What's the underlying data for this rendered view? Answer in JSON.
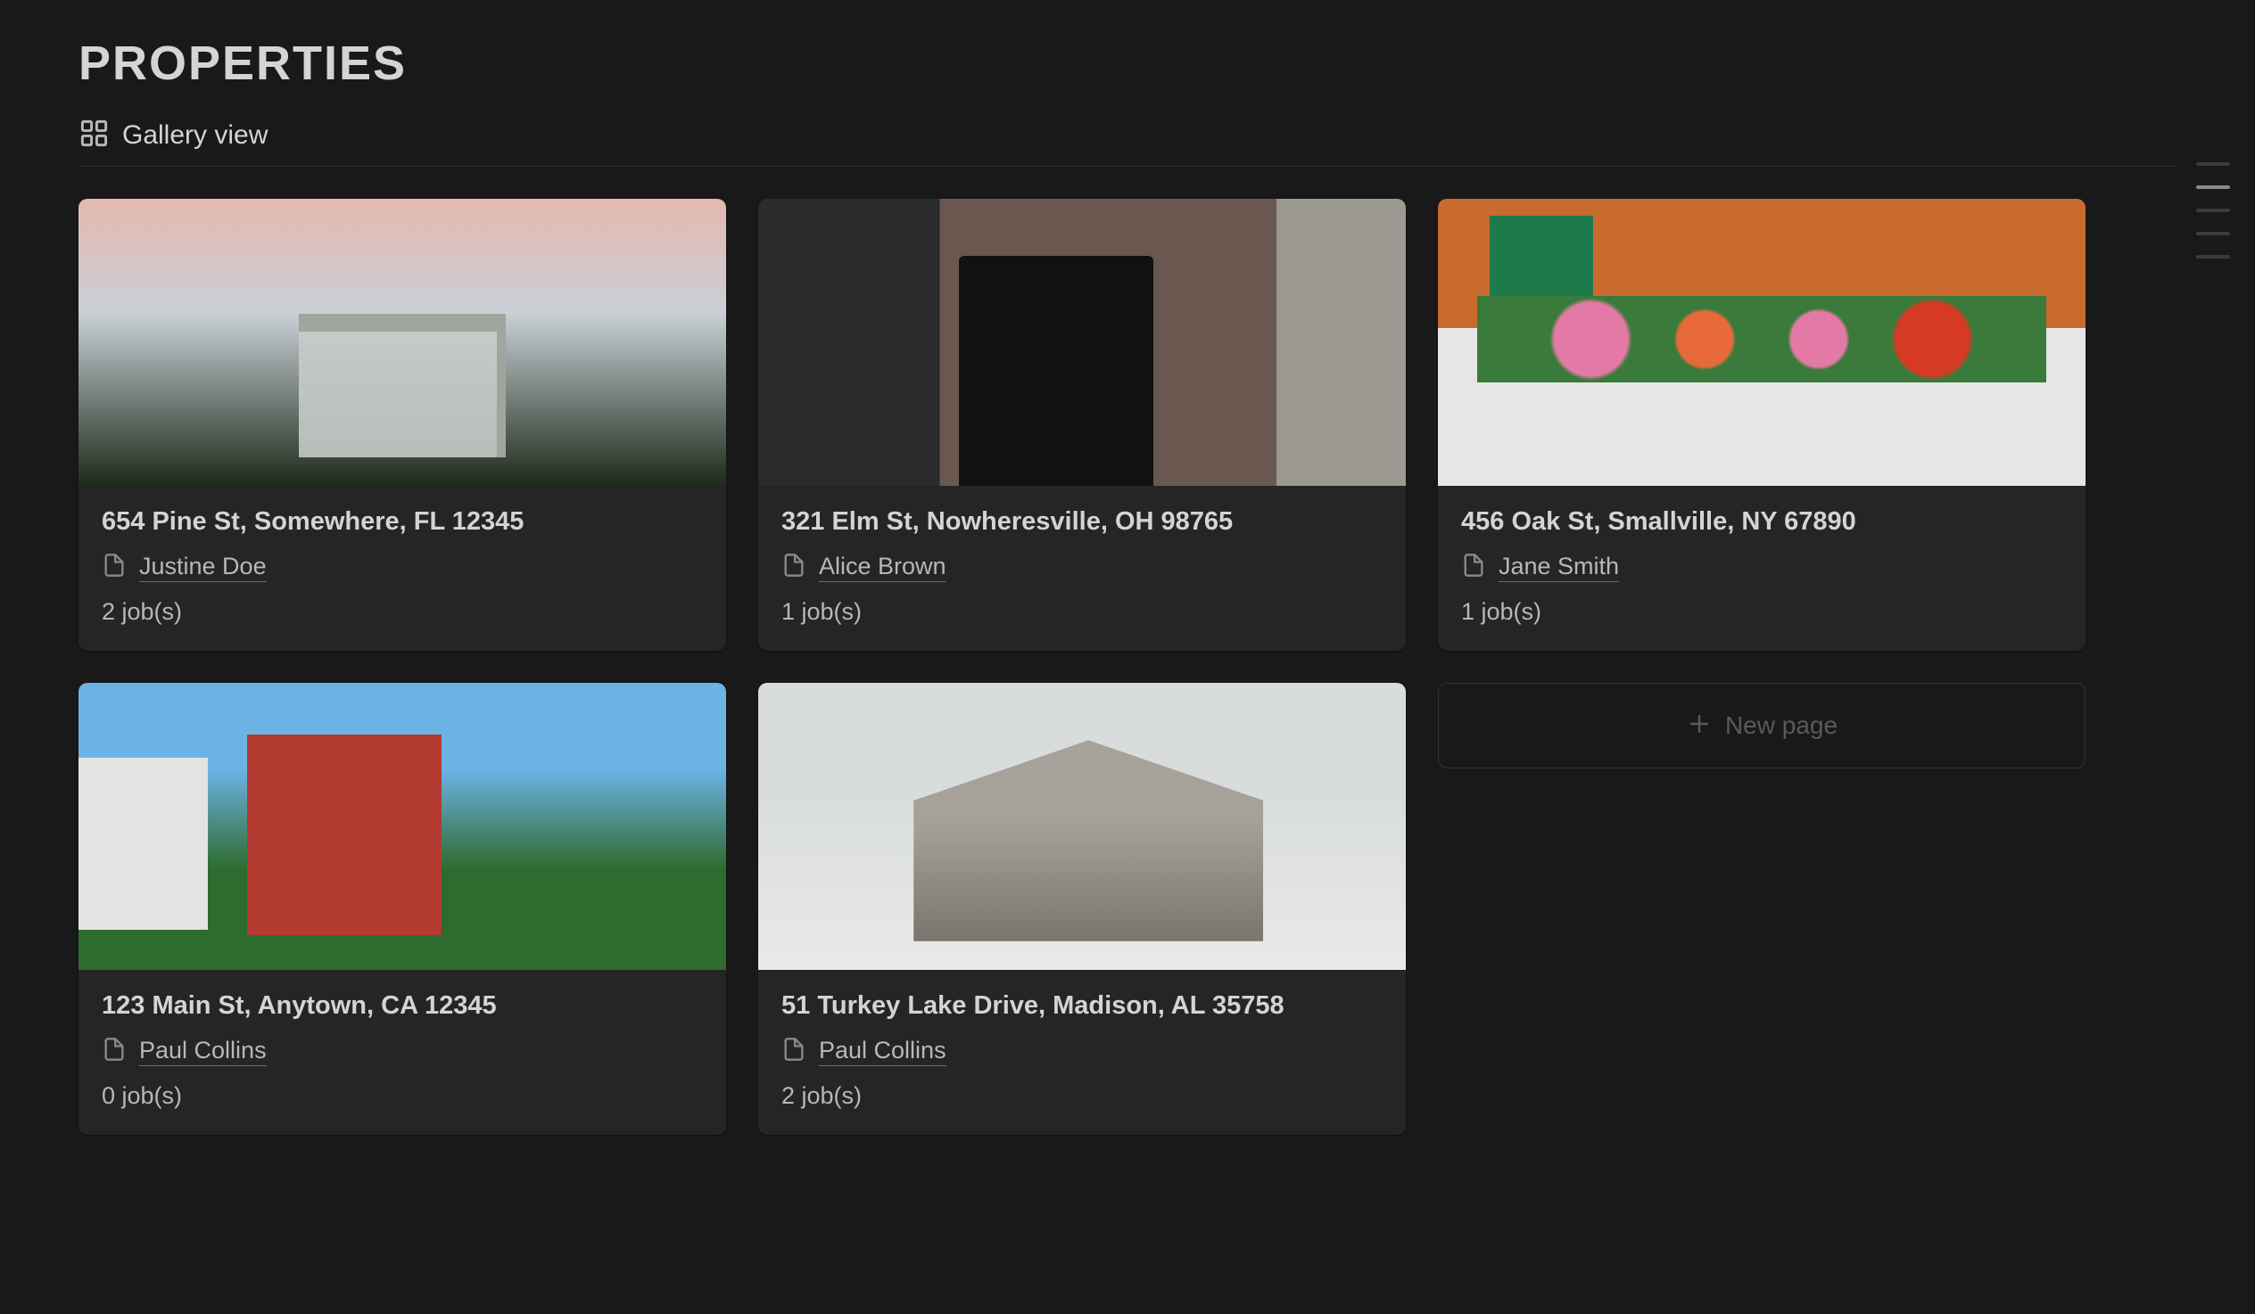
{
  "page_title": "PROPERTIES",
  "view": {
    "label": "Gallery view"
  },
  "new_page": {
    "label": "New page"
  },
  "properties": [
    {
      "address": "654 Pine St, Somewhere, FL 12345",
      "person": "Justine Doe",
      "jobs": "2 job(s)"
    },
    {
      "address": "321 Elm St, Nowheresville, OH 98765",
      "person": "Alice Brown",
      "jobs": "1 job(s)"
    },
    {
      "address": "456 Oak St, Smallville, NY 67890",
      "person": "Jane Smith",
      "jobs": "1 job(s)"
    },
    {
      "address": "123 Main St, Anytown, CA 12345",
      "person": "Paul Collins",
      "jobs": "0 job(s)"
    },
    {
      "address": "51 Turkey Lake Drive, Madison, AL 35758",
      "person": "Paul Collins",
      "jobs": "2 job(s)"
    }
  ],
  "outline": {
    "items": 5,
    "active_index": 1
  }
}
